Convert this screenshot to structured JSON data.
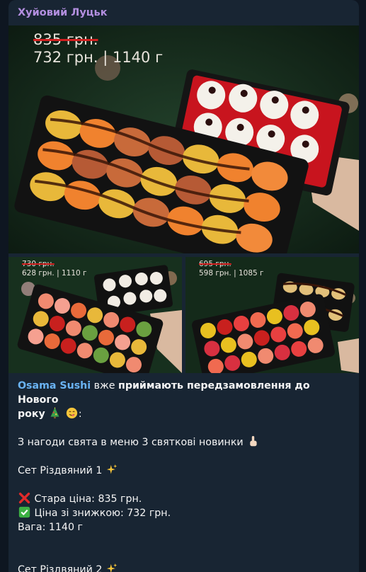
{
  "message": {
    "sender": "Хуйовий Луцьк",
    "link_text": "Osama Sushi",
    "intro_plain": " вже ",
    "intro_bold_1": "приймають передзамовлення до Нового",
    "intro_bold_2": "року",
    "colon": ":",
    "line_novelties": "З нагоди свята в меню 3 святкові новинки",
    "set1_title": "Сет Різдвяний 1",
    "old_price_line": "Стара ціна: 835 грн.",
    "discount_line": "Ціна зі знижкою: 732 грн.",
    "weight_line": "Вага: 1140 г",
    "set2_title": "Сет Різдвяний 2"
  },
  "photos": [
    {
      "old_price": "835 грн.",
      "new_price": "732 грн. | 1140 г"
    },
    {
      "old_price": "730 грн.",
      "new_price": "628 грн. | 1110 г"
    },
    {
      "old_price": "695 грн.",
      "new_price": "598 грн. | 1085 г"
    }
  ],
  "icons": {
    "tree": "christmas-tree-icon",
    "smile": "yum-face-icon",
    "finger": "pointing-up-icon",
    "sparkles": "sparkles-icon",
    "cross": "cross-mark-icon",
    "check": "check-mark-icon"
  },
  "colors": {
    "bubble": "#182533",
    "sender": "#b38fe0",
    "link": "#6ab3f3",
    "strike": "#d21f1f"
  }
}
